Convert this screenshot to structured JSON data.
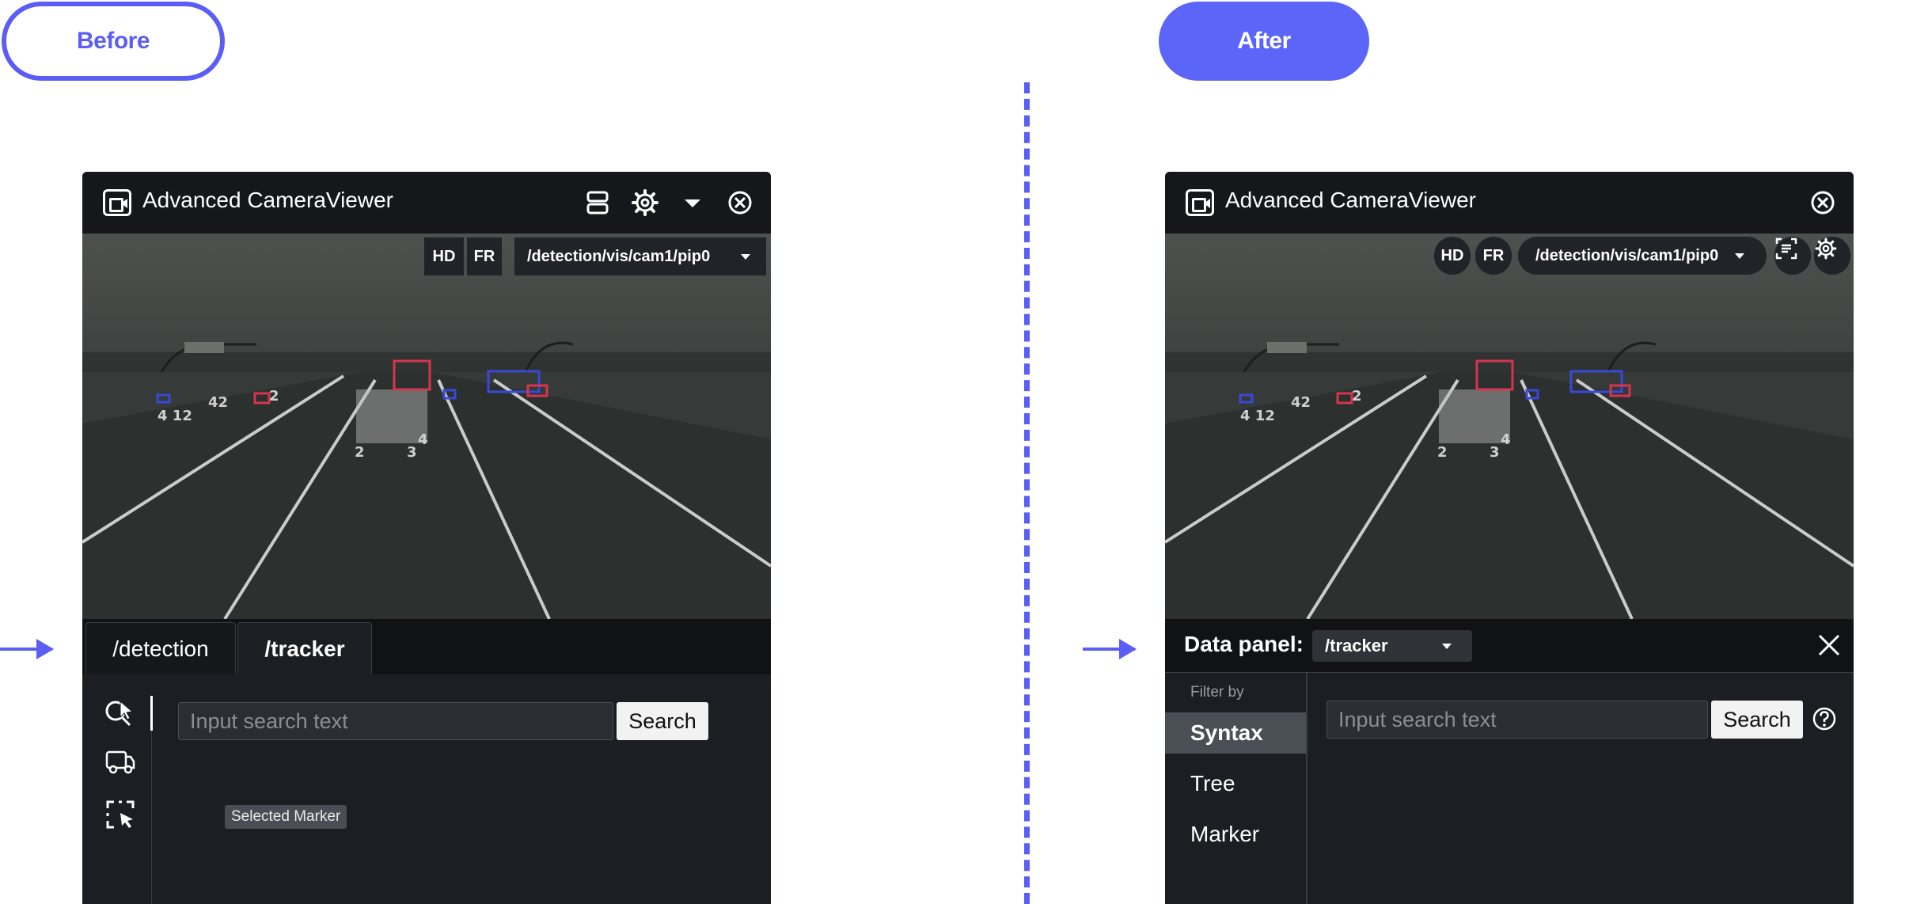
{
  "labels": {
    "before": "Before",
    "after": "After"
  },
  "before": {
    "title": "Advanced CameraViewer",
    "chips": {
      "hd": "HD",
      "fr": "FR",
      "topic": "/detection/vis/cam1/pip0"
    },
    "tabs": [
      {
        "label": "/detection"
      },
      {
        "label": "/tracker"
      }
    ],
    "search": {
      "placeholder": "Input search text",
      "button": "Search"
    },
    "tooltip": "Selected Marker"
  },
  "after": {
    "title": "Advanced CameraViewer",
    "chips": {
      "hd": "HD",
      "fr": "FR",
      "topic": "/detection/vis/cam1/pip0"
    },
    "data_panel": {
      "label": "Data panel:",
      "selected": "/tracker"
    },
    "filter": {
      "title": "Filter by",
      "items": [
        {
          "label": "Syntax"
        },
        {
          "label": "Tree"
        },
        {
          "label": "Marker"
        }
      ]
    },
    "search": {
      "placeholder": "Input search text",
      "button": "Search"
    }
  },
  "overlay_numbers": [
    "4 12",
    "42",
    "2",
    "2",
    "3",
    "4"
  ],
  "colors": {
    "accent": "#5b5ef5",
    "panel_bg": "#1b1e23",
    "titlebar_bg": "#15171a",
    "box_red": "#d8344e",
    "box_blue": "#3a48d8"
  }
}
